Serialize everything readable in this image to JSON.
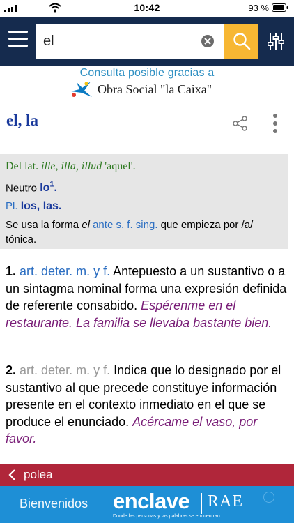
{
  "status_bar": {
    "time": "10:42",
    "battery": "93 %"
  },
  "header": {
    "search": {
      "value": "el",
      "placeholder": ""
    },
    "colors": {
      "bar": "#152b4e",
      "search_button": "#f7b733"
    },
    "icons": [
      "menu-icon",
      "clear-icon",
      "search-icon",
      "filter-icon"
    ]
  },
  "sponsor": {
    "line1": "Consulta posible gracias a",
    "line2": "Obra Social \"la Caixa\""
  },
  "entry": {
    "title": "el, la",
    "etymology": {
      "prefix": "Del lat.",
      "latin": "ille, illa, illud",
      "gloss": "'aquel'."
    },
    "neutro": {
      "label": "Neutro",
      "word": "lo",
      "sup": "1",
      "end": "."
    },
    "plural": {
      "label": "Pl.",
      "forms": "los, las."
    },
    "usage": {
      "a": "Se usa la forma",
      "b": "el",
      "c": "ante s. f. sing.",
      "d": "que empieza por /a/ tónica."
    },
    "definitions": [
      {
        "num": "1.",
        "abbr": "art. deter. m. y f.",
        "text": "Antepuesto a un sustantivo o a un sintagma nominal forma una expresión definida de referente consabido.",
        "example": "Espérenme en el restaurante. La familia se llevaba bastante bien."
      },
      {
        "num": "2.",
        "abbr": "art. deter. m. y f.",
        "text": "Indica que lo designado por el sustantivo al que precede constituye información presente en el contexto inmediato en el que se produce el enunciado.",
        "example": "Acércame el vaso, por favor."
      }
    ]
  },
  "navigation": {
    "previous": "polea"
  },
  "ad": {
    "welcome": "Bienvenidos",
    "brand": "enclave",
    "partner": "RAE",
    "tagline": "Donde las personas y las palabras se encuentran"
  }
}
